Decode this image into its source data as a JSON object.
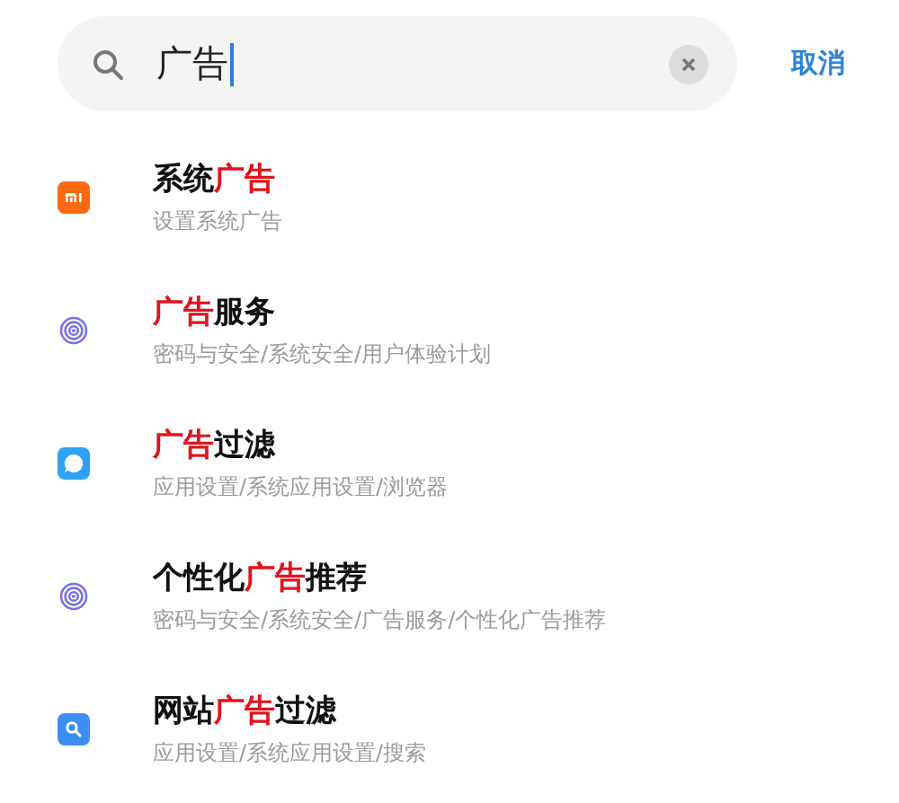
{
  "search": {
    "value": "广告",
    "focused": true
  },
  "cancel_label": "取消",
  "results": [
    {
      "kind": "mi",
      "title": [
        {
          "text": "系统",
          "highlight": false
        },
        {
          "text": "广告",
          "highlight": true
        }
      ],
      "path": "设置系统广告"
    },
    {
      "kind": "fingerprint",
      "title": [
        {
          "text": "广告",
          "highlight": true
        },
        {
          "text": "服务",
          "highlight": false
        }
      ],
      "path": "密码与安全/系统安全/用户体验计划"
    },
    {
      "kind": "bubble",
      "title": [
        {
          "text": "广告",
          "highlight": true
        },
        {
          "text": "过滤",
          "highlight": false
        }
      ],
      "path": "应用设置/系统应用设置/浏览器"
    },
    {
      "kind": "fingerprint",
      "title": [
        {
          "text": "个性化",
          "highlight": false
        },
        {
          "text": "广告",
          "highlight": true
        },
        {
          "text": "推荐",
          "highlight": false
        }
      ],
      "path": "密码与安全/系统安全/广告服务/个性化广告推荐"
    },
    {
      "kind": "search",
      "title": [
        {
          "text": "网站",
          "highlight": false
        },
        {
          "text": "广告",
          "highlight": true
        },
        {
          "text": "过滤",
          "highlight": false
        }
      ],
      "path": "应用设置/系统应用设置/搜索"
    }
  ]
}
